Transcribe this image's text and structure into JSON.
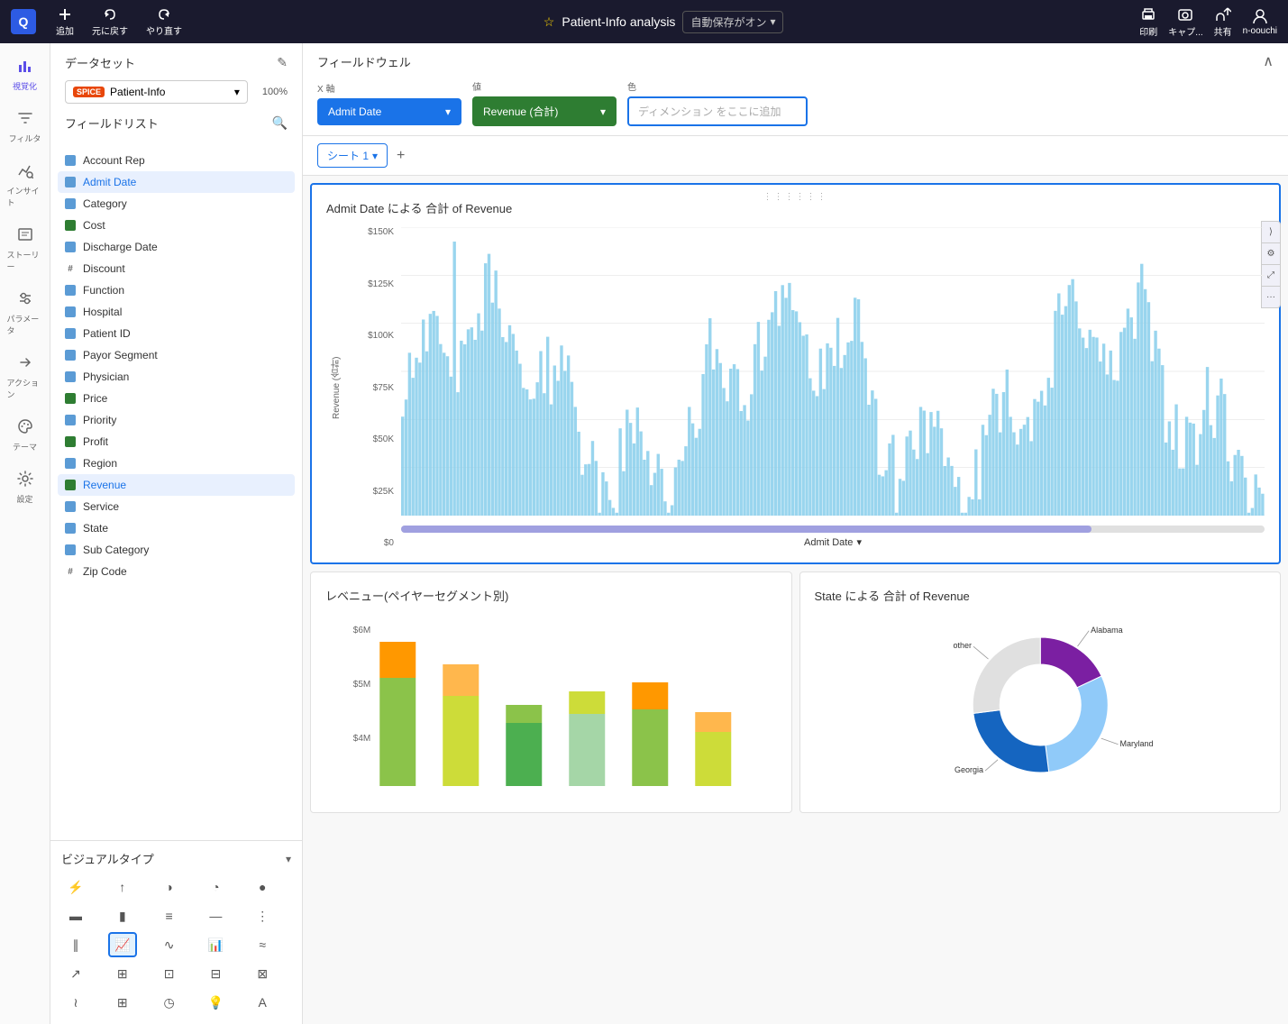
{
  "topbar": {
    "logo": "Q",
    "add_label": "追加",
    "undo_label": "元に戻す",
    "redo_label": "やり直す",
    "title": "Patient-Info analysis",
    "autosave_label": "自動保存がオン",
    "autosave_arrow": "▾",
    "print_label": "印刷",
    "capture_label": "キャプ...",
    "share_label": "共有",
    "user_label": "n-oouchi"
  },
  "sidebar": {
    "items": [
      {
        "id": "visualize",
        "icon": "📊",
        "label": "視覚化"
      },
      {
        "id": "filter",
        "icon": "⚡",
        "label": "フィルタ"
      },
      {
        "id": "insight",
        "icon": "📈",
        "label": "インサイト"
      },
      {
        "id": "story",
        "icon": "🎞",
        "label": "ストーリー"
      },
      {
        "id": "parameter",
        "icon": "⚙",
        "label": "パラメータ"
      },
      {
        "id": "action",
        "icon": "⚙",
        "label": "アクション"
      },
      {
        "id": "theme",
        "icon": "🎨",
        "label": "テーマ"
      },
      {
        "id": "settings",
        "icon": "⚙",
        "label": "設定"
      }
    ]
  },
  "left_panel": {
    "dataset_label": "データセット",
    "spice_badge": "SPICE",
    "dataset_name": "Patient-Info",
    "dataset_pct": "100%",
    "field_list_title": "フィールドリスト",
    "fields": [
      {
        "name": "Account Rep",
        "type": "dim"
      },
      {
        "name": "Admit Date",
        "type": "dim",
        "active": true
      },
      {
        "name": "Category",
        "type": "dim"
      },
      {
        "name": "Cost",
        "type": "measure"
      },
      {
        "name": "Discharge Date",
        "type": "dim"
      },
      {
        "name": "Discount",
        "type": "hash"
      },
      {
        "name": "Function",
        "type": "dim"
      },
      {
        "name": "Hospital",
        "type": "dim"
      },
      {
        "name": "Patient ID",
        "type": "dim"
      },
      {
        "name": "Payor Segment",
        "type": "dim"
      },
      {
        "name": "Physician",
        "type": "dim"
      },
      {
        "name": "Price",
        "type": "measure"
      },
      {
        "name": "Priority",
        "type": "dim"
      },
      {
        "name": "Profit",
        "type": "measure"
      },
      {
        "name": "Region",
        "type": "dim"
      },
      {
        "name": "Revenue",
        "type": "measure",
        "active": true
      },
      {
        "name": "Service",
        "type": "dim"
      },
      {
        "name": "State",
        "type": "dim"
      },
      {
        "name": "Sub Category",
        "type": "dim"
      },
      {
        "name": "Zip Code",
        "type": "hash"
      }
    ]
  },
  "visual_types": {
    "title": "ビジュアルタイプ",
    "items": [
      {
        "icon": "⚡",
        "label": "auto"
      },
      {
        "icon": "↑",
        "label": "kpi-arrow"
      },
      {
        "icon": "◑",
        "label": "gauge"
      },
      {
        "icon": "◔",
        "label": "donut-small"
      },
      {
        "icon": "●",
        "label": "pie"
      },
      {
        "icon": "▬",
        "label": "bar-h"
      },
      {
        "icon": "▮",
        "label": "bar-v"
      },
      {
        "icon": "≡",
        "label": "bar-stacked"
      },
      {
        "icon": "▭",
        "label": "bar-outline"
      },
      {
        "icon": "⋮",
        "label": "bar-group"
      },
      {
        "icon": "∥",
        "label": "col-v"
      },
      {
        "icon": "📈",
        "label": "line-active"
      },
      {
        "icon": "📉",
        "label": "area"
      },
      {
        "icon": "📊",
        "label": "combo"
      },
      {
        "icon": "≈",
        "label": "waterfall"
      },
      {
        "icon": "↗",
        "label": "line"
      },
      {
        "icon": "⊞",
        "label": "heat"
      },
      {
        "icon": "⊡",
        "label": "scatter"
      },
      {
        "icon": "⊟",
        "label": "pivot"
      },
      {
        "icon": "⊠",
        "label": "table"
      },
      {
        "icon": "∿",
        "label": "sparkline"
      },
      {
        "icon": "⊞",
        "label": "treemap"
      },
      {
        "icon": "◷",
        "label": "clock"
      },
      {
        "icon": "💡",
        "label": "insight"
      },
      {
        "icon": "A",
        "label": "text"
      }
    ]
  },
  "field_well": {
    "title": "フィールドウェル",
    "x_label": "X 軸",
    "x_value": "Admit Date",
    "value_label": "値",
    "value_value": "Revenue (合計)",
    "color_label": "色",
    "color_placeholder": "ディメンション をここに追加"
  },
  "sheets": {
    "tab_label": "シート 1",
    "tab_arrow": "▾"
  },
  "main_chart": {
    "title": "Admit Date による 合計 of Revenue",
    "y_axis_label": "Revenue (合計)",
    "y_labels": [
      "$150K",
      "$125K",
      "$100K",
      "$75K",
      "$50K",
      "$25K",
      "$0"
    ],
    "x_label": "Admit Date",
    "drag_indicator": "⋮⋮⋮⋮⋮⋮"
  },
  "bottom_left_chart": {
    "title": "レベニュー(ペイヤーセグメント別)",
    "y_labels": [
      "$6M",
      "$5M",
      "$4M"
    ],
    "bar_colors": [
      "#8bc34a",
      "#cddc39",
      "#ff9800",
      "#ffb74d",
      "#4caf50",
      "#a5d6a7"
    ]
  },
  "bottom_right_chart": {
    "title": "State による 合計 of Revenue",
    "segments": [
      {
        "label": "Alabama",
        "color": "#7b1fa2",
        "pct": 18
      },
      {
        "label": "Maryland",
        "color": "#90caf9",
        "pct": 30
      },
      {
        "label": "Georgia",
        "color": "#1565c0",
        "pct": 25
      },
      {
        "label": "other",
        "color": "#e0e0e0",
        "pct": 27
      }
    ]
  }
}
